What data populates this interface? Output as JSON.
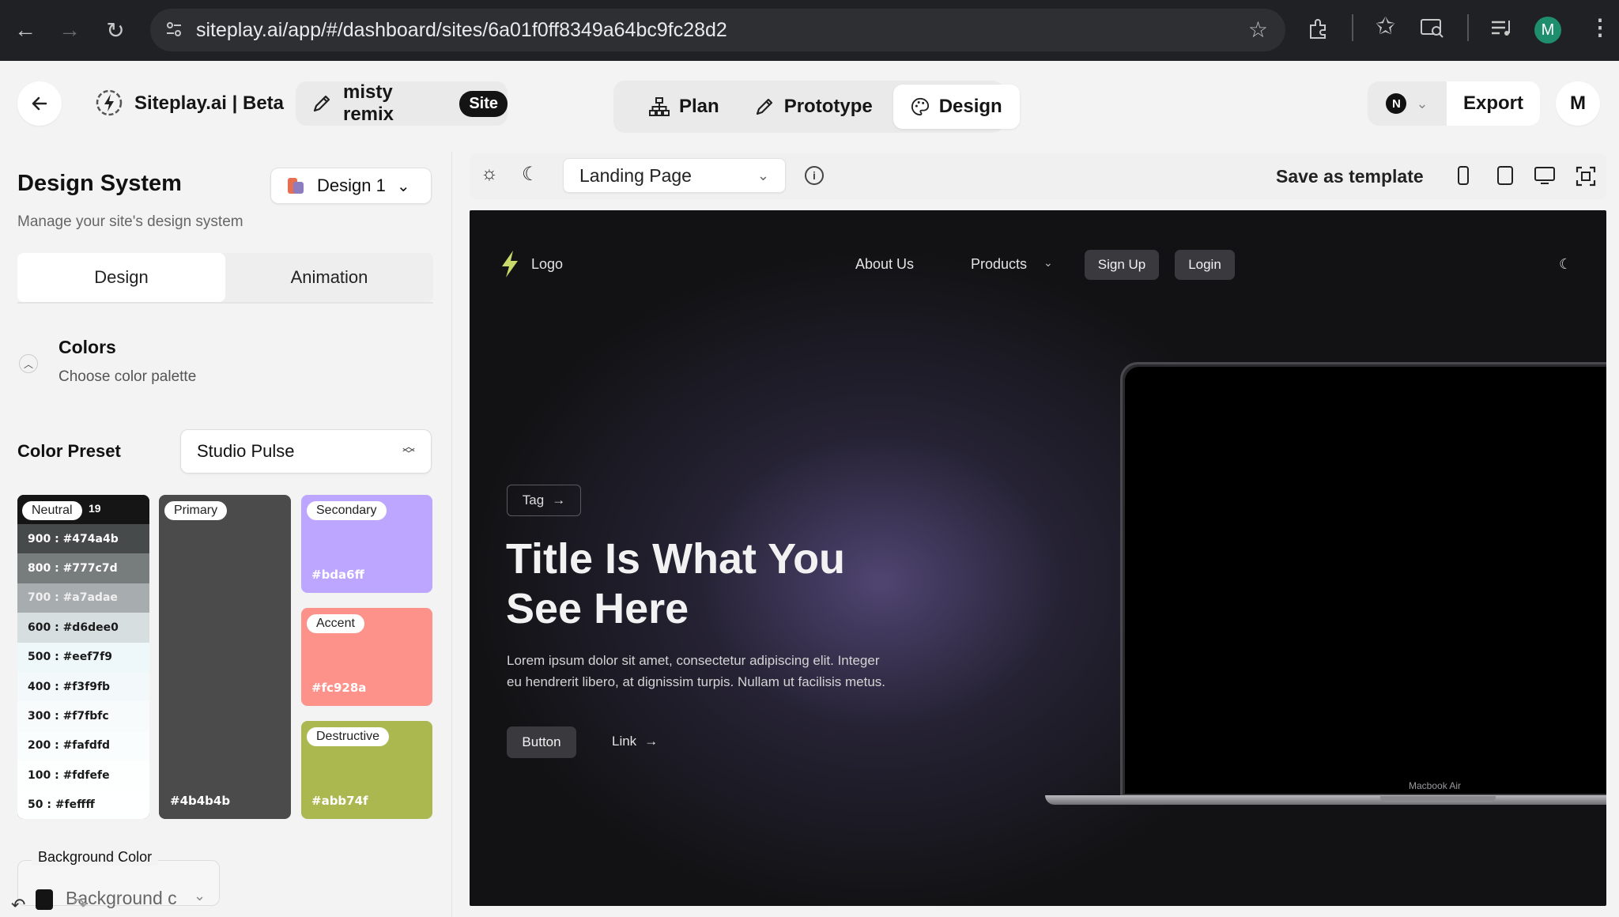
{
  "browser": {
    "url": "siteplay.ai/app/#/dashboard/sites/6a01f0ff8349a64bc9fc28d2",
    "profile_initial": "M"
  },
  "header": {
    "brand": "Siteplay.ai | Beta",
    "site_name": "misty remix",
    "site_badge": "Site",
    "tabs": [
      {
        "label": "Plan",
        "icon": "sitemap-icon"
      },
      {
        "label": "Prototype",
        "icon": "pencil-icon"
      },
      {
        "label": "Design",
        "icon": "palette-icon"
      }
    ],
    "framework_initial": "N",
    "export_label": "Export",
    "user_initial": "M"
  },
  "left_panel": {
    "title": "Design System",
    "subtitle": "Manage your site's design system",
    "design_selector": "Design 1",
    "tabs": [
      "Design",
      "Animation"
    ],
    "colors_title": "Colors",
    "colors_subtitle": "Choose color palette",
    "preset_label": "Color Preset",
    "preset_value": "Studio Pulse",
    "neutral": {
      "chip": "Neutral",
      "partial": "19",
      "shades": [
        {
          "label": "900 : #474a4b",
          "bg": "#474a4b",
          "fg": "#ffffff"
        },
        {
          "label": "800 : #777c7d",
          "bg": "#777c7d",
          "fg": "#ffffff"
        },
        {
          "label": "700 : #a7adae",
          "bg": "#a7adae",
          "fg": "#f0f0f0"
        },
        {
          "label": "600 : #d6dee0",
          "bg": "#d6dee0",
          "fg": "#1a1a1a"
        },
        {
          "label": "500 : #eef7f9",
          "bg": "#eef7f9",
          "fg": "#1a1a1a"
        },
        {
          "label": "400 : #f3f9fb",
          "bg": "#f3f9fb",
          "fg": "#1a1a1a"
        },
        {
          "label": "300 : #f7fbfc",
          "bg": "#f7fbfc",
          "fg": "#1a1a1a"
        },
        {
          "label": "200 : #fafdfd",
          "bg": "#fafdfd",
          "fg": "#1a1a1a"
        },
        {
          "label": "100 : #fdfefe",
          "bg": "#fdfefe",
          "fg": "#1a1a1a"
        },
        {
          "label": "50 : #feffff",
          "bg": "#feffff",
          "fg": "#1a1a1a"
        }
      ]
    },
    "primary": {
      "chip": "Primary",
      "value": "#4b4b4b",
      "color": "#4b4b4b"
    },
    "secondary": {
      "chip": "Secondary",
      "value": "#bda6ff",
      "color": "#bda6ff"
    },
    "accent": {
      "chip": "Accent",
      "value": "#fc928a",
      "color": "#fc928a"
    },
    "destructive": {
      "chip": "Destructive",
      "value": "#abb74f",
      "color": "#abb74f"
    },
    "background_label": "Background Color",
    "background_value": "Background c"
  },
  "toolbar": {
    "page_select": "Landing Page",
    "save_template": "Save as template"
  },
  "preview": {
    "logo": "Logo",
    "nav": [
      "About Us",
      "Products"
    ],
    "signup": "Sign Up",
    "login": "Login",
    "tag": "Tag",
    "title_line1": "Title Is What You",
    "title_line2": "See Here",
    "body_line1": "Lorem ipsum dolor sit amet, consectetur adipiscing elit. Integer",
    "body_line2": "eu hendrerit libero, at dignissim turpis. Nullam ut facilisis metus.",
    "button": "Button",
    "link": "Link",
    "device_label": "Macbook Air"
  }
}
